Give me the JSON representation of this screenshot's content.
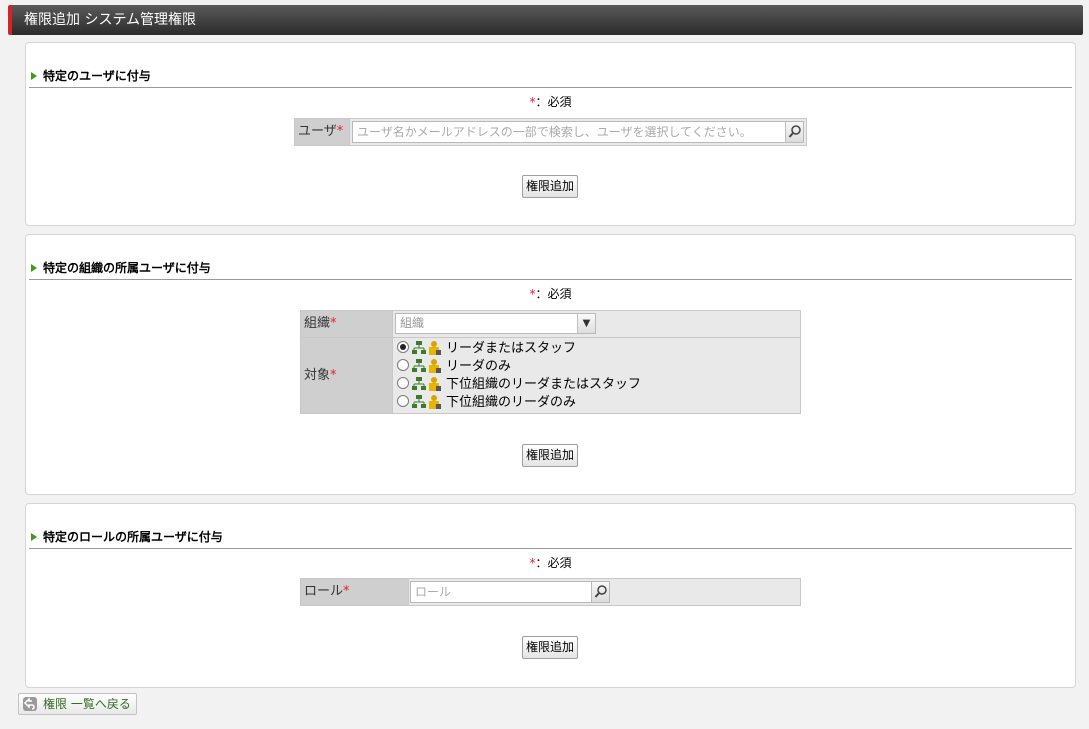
{
  "window": {
    "title": "権限追加 システム管理権限"
  },
  "required_note": {
    "star": "*",
    "text": "：必須"
  },
  "section_user": {
    "heading": "特定のユーザに付与",
    "field_label": "ユーザ",
    "search_placeholder": "ユーザ名かメールアドレスの一部で検索し、ユーザを選択してください。",
    "submit_label": "権限追加"
  },
  "section_org": {
    "heading": "特定の組織の所属ユーザに付与",
    "org_label": "組織",
    "org_placeholder": "組織",
    "target_label": "対象",
    "options": [
      {
        "label": "リーダまたはスタッフ",
        "selected": true
      },
      {
        "label": "リーダのみ",
        "selected": false
      },
      {
        "label": "下位組織のリーダまたはスタッフ",
        "selected": false
      },
      {
        "label": "下位組織のリーダのみ",
        "selected": false
      }
    ],
    "submit_label": "権限追加"
  },
  "section_role": {
    "heading": "特定のロールの所属ユーザに付与",
    "field_label": "ロール",
    "search_placeholder": "ロール",
    "submit_label": "権限追加"
  },
  "back_link": {
    "label": "権限 一覧へ戻る",
    "icon": "back-arrow-icon"
  },
  "colors": {
    "accent": "#d3242c",
    "required": "#e0212b",
    "section_marker": "#3a9a1a"
  }
}
